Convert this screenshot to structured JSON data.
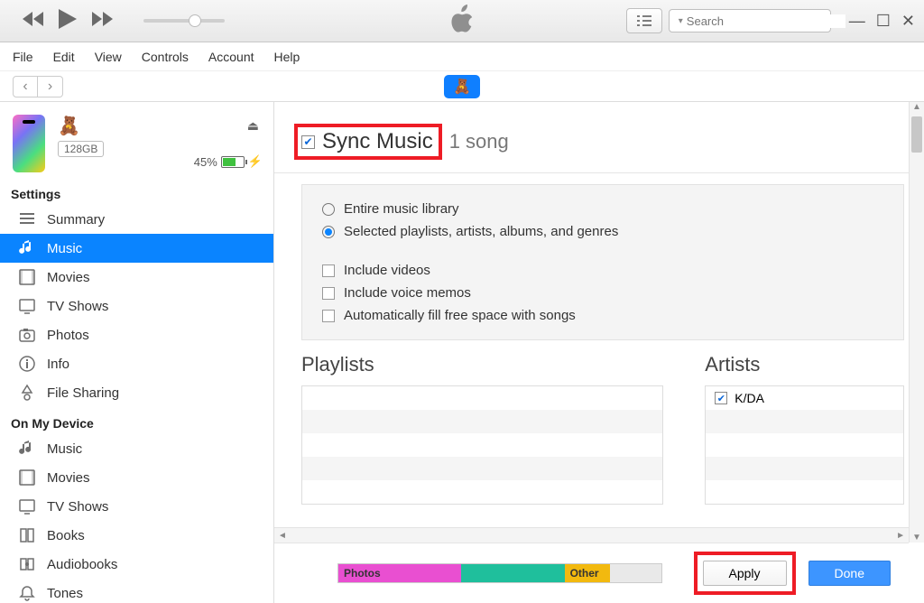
{
  "search": {
    "placeholder": "Search"
  },
  "menubar": [
    "File",
    "Edit",
    "View",
    "Controls",
    "Account",
    "Help"
  ],
  "device": {
    "storage": "128GB",
    "battery_pct": "45%"
  },
  "sidebar": {
    "settings_header": "Settings",
    "settings": [
      {
        "icon": "list",
        "label": "Summary"
      },
      {
        "icon": "music",
        "label": "Music"
      },
      {
        "icon": "film",
        "label": "Movies"
      },
      {
        "icon": "tv",
        "label": "TV Shows"
      },
      {
        "icon": "camera",
        "label": "Photos"
      },
      {
        "icon": "info",
        "label": "Info"
      },
      {
        "icon": "share",
        "label": "File Sharing"
      }
    ],
    "device_header": "On My Device",
    "device_items": [
      {
        "icon": "music",
        "label": "Music"
      },
      {
        "icon": "film",
        "label": "Movies"
      },
      {
        "icon": "tv",
        "label": "TV Shows"
      },
      {
        "icon": "book",
        "label": "Books"
      },
      {
        "icon": "audiobook",
        "label": "Audiobooks"
      },
      {
        "icon": "bell",
        "label": "Tones"
      }
    ]
  },
  "sync": {
    "checkbox_checked": true,
    "title": "Sync Music",
    "count_label": "1 song",
    "option_entire": "Entire music library",
    "option_selected": "Selected playlists, artists, albums, and genres",
    "include_videos": "Include videos",
    "include_voice": "Include voice memos",
    "auto_fill": "Automatically fill free space with songs"
  },
  "columns": {
    "playlists_header": "Playlists",
    "artists_header": "Artists",
    "artists": [
      {
        "checked": true,
        "name": "K/DA"
      }
    ]
  },
  "usage": {
    "segments": [
      {
        "label": "Photos",
        "color": "#e94fd1",
        "width": "38%"
      },
      {
        "label": "",
        "color": "#1fbf9c",
        "width": "32%"
      },
      {
        "label": "Other",
        "color": "#f2b90f",
        "width": "14%"
      }
    ]
  },
  "buttons": {
    "apply": "Apply",
    "done": "Done"
  }
}
